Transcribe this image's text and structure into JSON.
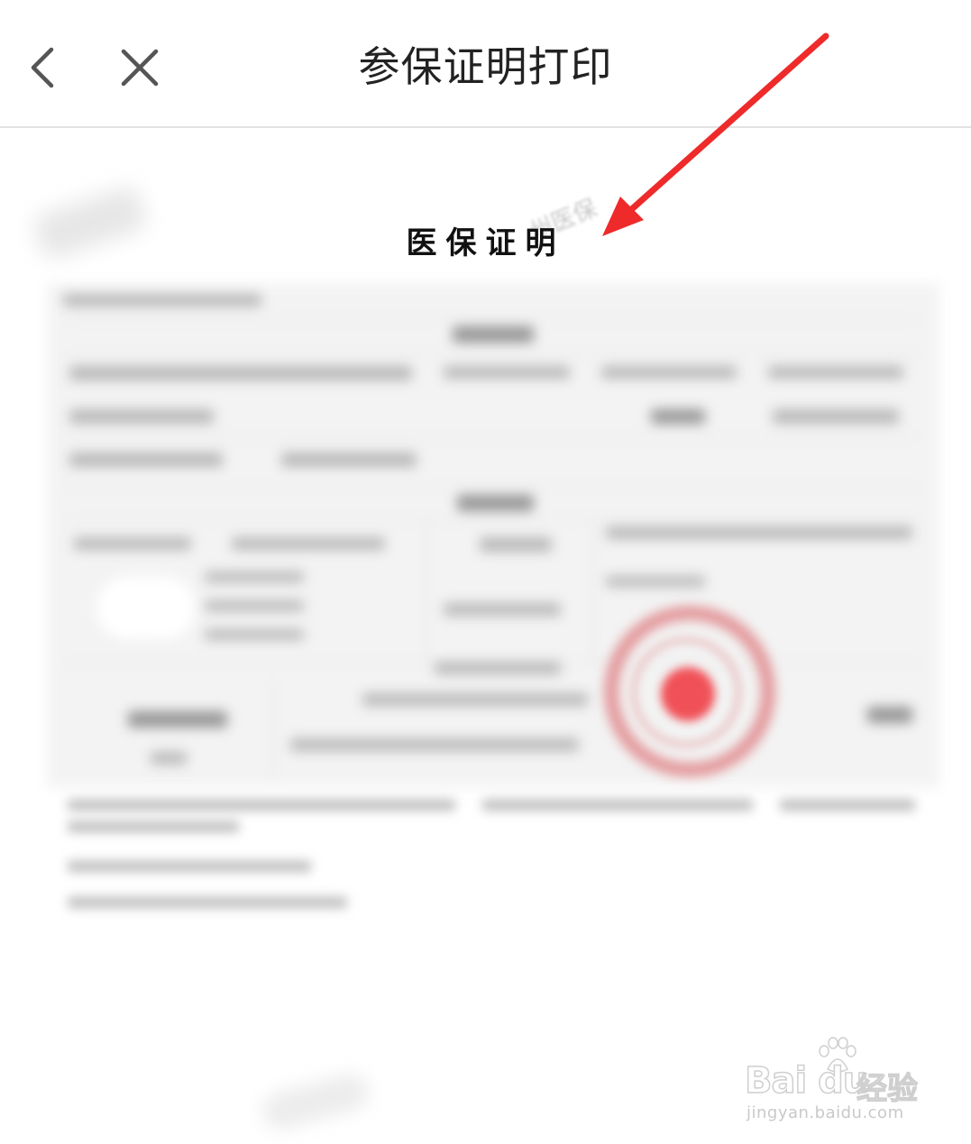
{
  "navbar": {
    "title": "参保证明打印",
    "back_icon": "chevron-left-icon",
    "close_icon": "close-icon"
  },
  "document": {
    "title": "医保证明",
    "faint_watermark": "州医保",
    "stamp_color": "#f05158"
  },
  "annotation": {
    "arrow_color": "#ee2a2a"
  },
  "watermark": {
    "logo_text": "Bai du",
    "logo_cn": "经验",
    "url": "jingyan.baidu.com"
  }
}
